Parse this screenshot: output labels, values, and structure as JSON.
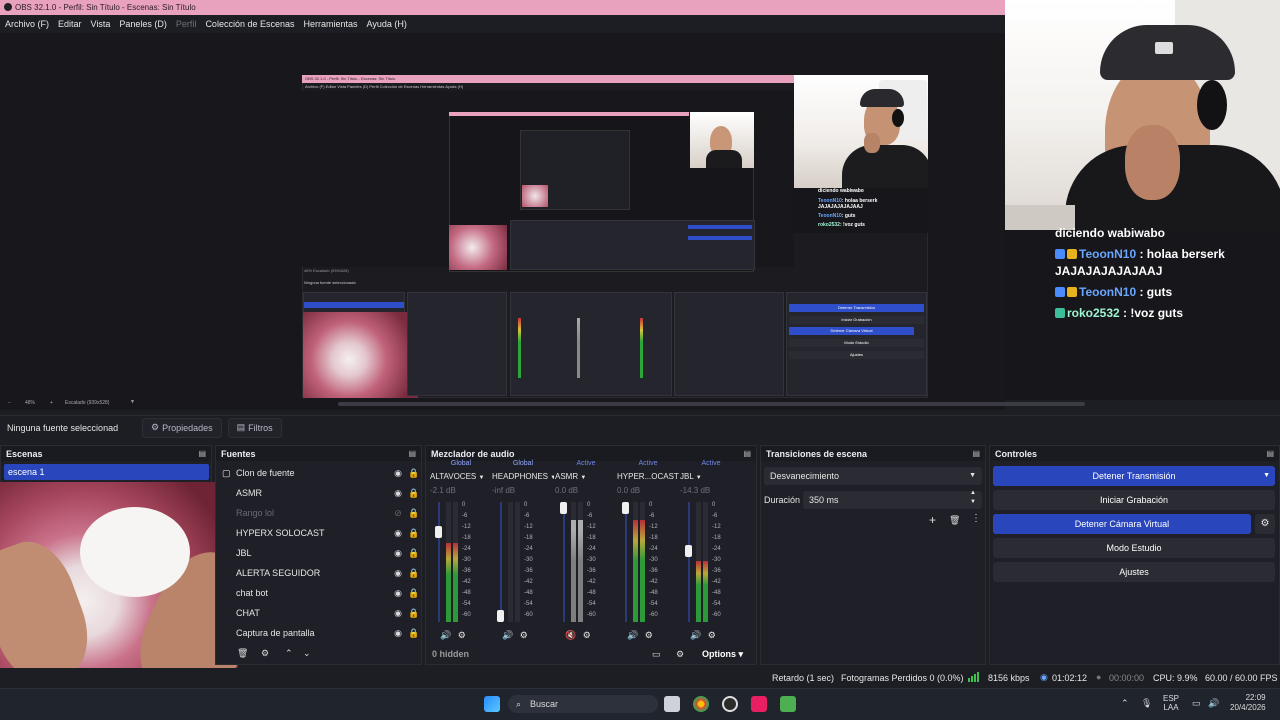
{
  "window": {
    "title": "OBS 32.1.0 - Perfil: Sin Título - Escenas: Sin Título"
  },
  "menu": [
    "Archivo (F)",
    "Editar",
    "Vista",
    "Paneles (D)",
    "Perfil",
    "Colección de Escenas",
    "Herramientas",
    "Ayuda (H)"
  ],
  "nested_preview": {
    "title": "OBS 32.1.0 - Perfil: Sin Título - Escenas: Sin Título",
    "menu": "Archivo (F)   Editar   Vista   Paneles (D)   Perfil   Colección de Escenas   Herramientas   Ayuda (H)",
    "chat": [
      {
        "user": "",
        "text": "diciendo wabiwabo"
      },
      {
        "user": "TeoonN10",
        "text": ": holaa berserk JAJAJAJAJAJAAJ"
      },
      {
        "user": "TeoonN10",
        "text": ": guts"
      },
      {
        "user": "roko2532",
        "text": ": !voz guts"
      }
    ],
    "controls": [
      "Detener Transmisión",
      "Iniciar Grabación",
      "Detener Cámara Virtual",
      "Modo Estudio",
      "Ajustes"
    ],
    "no_source": "Ninguna fuente seleccionada",
    "zoom": "48%",
    "scale": "Escalado (939x528)"
  },
  "chat": {
    "top_line": "diciendo wabiwabo",
    "messages": [
      {
        "user": "TeoonN10",
        "text": " : holaa berserk",
        "cont": "JAJAJAJAJAJAAJ"
      },
      {
        "user": "TeoonN10",
        "text": " : guts",
        "cont": ""
      },
      {
        "user": "roko2532",
        "text": " : !voz guts",
        "cont": ""
      }
    ]
  },
  "preview_bottom": {
    "zoom": "48%",
    "scale": "Escalado (939x528)"
  },
  "propbar": {
    "no_source": "Ninguna fuente seleccionad",
    "properties": "Propiedades",
    "filters": "Filtros"
  },
  "scenes": {
    "title": "Escenas",
    "items": [
      "escena 1"
    ]
  },
  "sources": {
    "title": "Fuentes",
    "items": [
      "Clon de fuente",
      "ASMR",
      "Rango lol",
      "HYPERX SOLOCAST",
      "JBL",
      "ALERTA SEGUIDOR",
      "chat bot",
      "CHAT",
      "Captura de pantalla"
    ]
  },
  "mixer": {
    "title": "Mezclador de audio",
    "hidden": "0 hidden",
    "options": "Options",
    "channels": [
      {
        "tag": "Global",
        "name": "ALTAVOCES",
        "db": "-2.1 dB",
        "level": 0.78
      },
      {
        "tag": "Global",
        "name": "HEADPHONES",
        "db": "-inf dB",
        "level": 0.0
      },
      {
        "tag": "Active",
        "name": "ASMR",
        "db": "0.0 dB",
        "level": 1.0
      },
      {
        "tag": "Active",
        "name": "HYPER...OCAST",
        "db": "0.0 dB",
        "level": 1.0
      },
      {
        "tag": "Active",
        "name": "JBL",
        "db": "-14.3 dB",
        "level": 0.6
      }
    ],
    "scale": [
      "0",
      "-6",
      "-12",
      "-18",
      "-24",
      "-30",
      "-36",
      "-42",
      "-48",
      "-54",
      "-60"
    ]
  },
  "transitions": {
    "title": "Transiciones de escena",
    "selected": "Desvanecimiento",
    "duration_label": "Duración",
    "duration_value": "350 ms"
  },
  "controls": {
    "title": "Controles",
    "stop_stream": "Detener Transmisión",
    "start_record": "Iniciar Grabación",
    "stop_vcam": "Detener Cámara Virtual",
    "studio_mode": "Modo Estudio",
    "settings": "Ajustes"
  },
  "status": {
    "delay": "Retardo (1 sec)",
    "dropped": "Fotogramas Perdidos 0 (0.0%)",
    "bitrate": "8156 kbps",
    "stream_time": "01:02:12",
    "rec_time": "00:00:00",
    "cpu": "CPU: 9.9%",
    "fps": "60.00 / 60.00 FPS"
  },
  "taskbar": {
    "search": "Buscar",
    "lang1": "ESP",
    "lang2": "LAA",
    "time": "22:09",
    "date": "20/4/2026"
  },
  "colors": {
    "accent": "#2a46bd",
    "titlebar": "#e9a2be",
    "chat_name": "#6aa6ff",
    "chat_name_green": "#9ff5d1"
  }
}
